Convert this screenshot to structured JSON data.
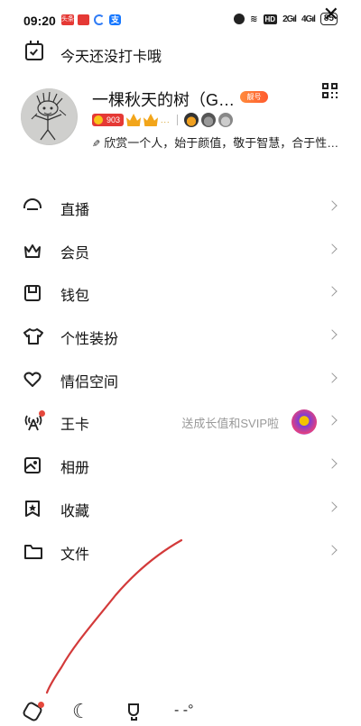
{
  "status_bar": {
    "time": "09:20",
    "app_badges": [
      "头条",
      "mail",
      "c",
      "支"
    ],
    "network_labels": [
      "HD",
      "2G",
      "4G"
    ],
    "battery": "85"
  },
  "checkin": {
    "text": "今天还没打卡哦",
    "icon": "calendar-check-icon",
    "close_icon": "close-icon",
    "close_label": "✕"
  },
  "profile": {
    "nickname": "一棵秋天的树（G…",
    "vip_tag": "靓号",
    "level": "903",
    "dots": "...",
    "signature": "欣赏一个人，始于颜值，敬于智慧，合于性格，久于善良，终于人品。",
    "pencil": "✎"
  },
  "menu": [
    {
      "label": "直播",
      "icon": "live-icon"
    },
    {
      "label": "会员",
      "icon": "crown-icon"
    },
    {
      "label": "钱包",
      "icon": "wallet-icon"
    },
    {
      "label": "个性装扮",
      "icon": "tshirt-icon"
    },
    {
      "label": "情侣空间",
      "icon": "heart-icon",
      "icon_glyph": "♡"
    },
    {
      "label": "王卡",
      "icon": "signal-card-icon",
      "icon_glyph": "((ᴧ))",
      "extra": "送成长值和SVIP啦",
      "has_dot": true
    },
    {
      "label": "相册",
      "icon": "album-icon"
    },
    {
      "label": "收藏",
      "icon": "bookmark-star-icon",
      "icon_glyph": "★"
    },
    {
      "label": "文件",
      "icon": "folder-icon"
    }
  ],
  "bottom_bar": {
    "settings_icon": "settings-icon",
    "night_mode_icon": "moon-icon",
    "night_mode_glyph": "☾",
    "trophy_icon": "trophy-icon",
    "weather_text": "- -°"
  },
  "colors": {
    "accent_red": "#e5483c",
    "text": "#111111",
    "muted": "#999999",
    "scribble": "#d33a3a"
  }
}
